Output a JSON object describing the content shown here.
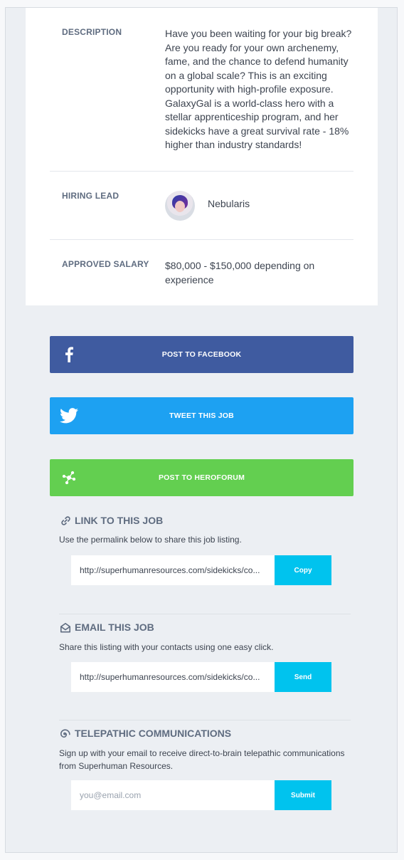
{
  "details": {
    "description_label": "DESCRIPTION",
    "description_text": "Have you been waiting for your big break? Are you ready for your own archenemy, fame, and the chance to defend humanity on a global scale? This is an exciting opportunity with high-profile exposure. GalaxyGal is a world-class hero with a stellar apprenticeship program, and her sidekicks have a great survival rate - 18% higher than industry standards!",
    "hiring_lead_label": "HIRING LEAD",
    "hiring_lead_name": "Nebularis",
    "salary_label": "APPROVED SALARY",
    "salary_text": "$80,000 - $150,000 depending on experience"
  },
  "share": {
    "facebook_label": "POST TO FACEBOOK",
    "twitter_label": "TWEET THIS JOB",
    "heroforum_label": "POST TO HEROFORUM",
    "facebook_color": "#3f5ba0",
    "twitter_color": "#1da1f2",
    "heroforum_color": "#63cf50"
  },
  "link_section": {
    "title": "LINK TO THIS JOB",
    "icon": "link-icon",
    "description": "Use the permalink below to share this job listing.",
    "value": "http://superhumanresources.com/sidekicks/co...",
    "button_label": "Copy"
  },
  "email_section": {
    "title": "EMAIL THIS JOB",
    "icon": "envelope-icon",
    "description": "Share this listing with your contacts using one easy click.",
    "value": "http://superhumanresources.com/sidekicks/co...",
    "button_label": "Send"
  },
  "telepathic_section": {
    "title": "TELEPATHIC COMMUNICATIONS",
    "icon": "spiral-icon",
    "description": "Sign up with your email to receive direct-to-brain telepathic communications from Superhuman Resources.",
    "placeholder": "you@email.com",
    "button_label": "Submit"
  },
  "accent_color": "#00c3ee"
}
